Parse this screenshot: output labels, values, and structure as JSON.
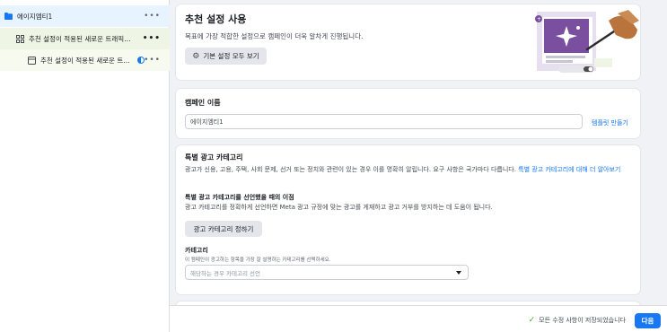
{
  "sidebar": {
    "campaign": {
      "label": "에이지엠티1",
      "more": "•••"
    },
    "adset": {
      "label": "추천 설정이 적용된 새로운 트래픽 ...",
      "more": "•••"
    },
    "ad": {
      "label": "추천 설정이 적용된 새로운 트...",
      "more": "•••"
    }
  },
  "recommend": {
    "title": "추천 설정 사용",
    "subtitle": "목표에 가장 적합한 설정으로 캠페인이 더욱 알차게 진행됩니다.",
    "button_label": "기본 설정 모두 보기"
  },
  "campaign_name": {
    "title": "캠페인 이름",
    "value": "에이지엠티1",
    "template_link": "템플릿 만들기"
  },
  "special_category": {
    "title": "특별 광고 카테고리",
    "description": "광고가 신용, 고용, 주택, 사회 문제, 선거 또는 정치와 관련이 있는 경우 이를 명확히 알립니다. 요구 사항은 국가마다 다릅니다.",
    "learn_more_link": "특별 광고 카테고리에 대해 더 알아보기",
    "benefit_title": "특별 광고 카테고리를 선언했을 때의 이점",
    "benefit_text": "광고 카테고리를 정확하게 선언하면 Meta 광고 규정에 맞는 광고를 게재하고 광고 거부를 방지하는 데 도움이 됩니다.",
    "declare_button": "광고 카테고리 정하기",
    "category_label": "카테고리",
    "category_help": "이 캠페인이 광고하는 항목을 가장 잘 설명하는 카테고리를 선택하세요.",
    "category_placeholder": "해당하는 경우 카테고리 선언"
  },
  "footer": {
    "saved_status": "모든 수정 사항이 저장되었습니다",
    "next_button": "다음"
  },
  "colors": {
    "accent": "#1877f2",
    "success": "#42b72a",
    "illustration_purple": "#7b4fa0"
  }
}
